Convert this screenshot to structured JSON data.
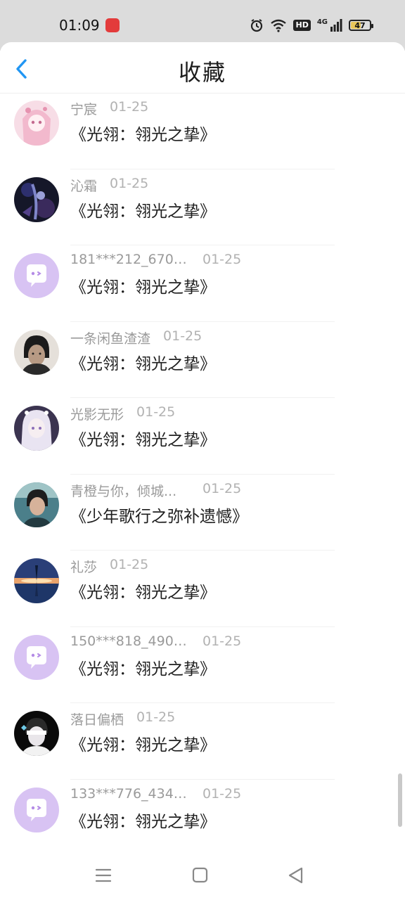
{
  "status_bar": {
    "time": "01:09",
    "battery": "47",
    "hd_badge": "HD",
    "network_label": "4G",
    "icons": [
      "app-notification-icon",
      "alarm-icon",
      "wifi-icon",
      "hd-icon",
      "signal-icon",
      "battery-icon"
    ]
  },
  "header": {
    "title": "收藏",
    "back_icon": "chevron-left-icon",
    "accent_color": "#2196f3"
  },
  "items": [
    {
      "name": "宁宸",
      "date": "01-25",
      "title": "《光翎：翎光之挚》",
      "avatar": "avatar-pink-anime-girl"
    },
    {
      "name": "沁霜",
      "date": "01-25",
      "title": "《光翎：翎光之挚》",
      "avatar": "avatar-dark-character"
    },
    {
      "name": "181***212_6701...",
      "date": "01-25",
      "title": "《光翎：翎光之挚》",
      "avatar": "default-chat-avatar"
    },
    {
      "name": "一条闲鱼渣渣",
      "date": "01-25",
      "title": "《光翎：翎光之挚》",
      "avatar": "avatar-man-portrait"
    },
    {
      "name": "光影无形",
      "date": "01-25",
      "title": "《光翎：翎光之挚》",
      "avatar": "avatar-white-hair-girl"
    },
    {
      "name": "青橙与你，倾城...",
      "date": "01-25",
      "title": "《少年歌行之弥补遗憾》",
      "avatar": "avatar-man-photo"
    },
    {
      "name": "礼莎",
      "date": "01-25",
      "title": "《光翎：翎光之挚》",
      "avatar": "avatar-sunset-scene"
    },
    {
      "name": "150***818_4906...",
      "date": "01-25",
      "title": "《光翎：翎光之挚》",
      "avatar": "default-chat-avatar"
    },
    {
      "name": "落日偏栖",
      "date": "01-25",
      "title": "《光翎：翎光之挚》",
      "avatar": "avatar-boy-blindfold"
    },
    {
      "name": "133***776_4349...",
      "date": "01-25",
      "title": "《光翎：翎光之挚》",
      "avatar": "default-chat-avatar"
    }
  ],
  "nav_bar": {
    "buttons": [
      "menu-icon",
      "home-square-icon",
      "back-triangle-icon"
    ]
  },
  "colors": {
    "default_avatar_bg": "#d8c3f3",
    "name_text": "#9a9a9a",
    "date_text": "#b2b2b2",
    "title_text": "#1e1e1e"
  }
}
